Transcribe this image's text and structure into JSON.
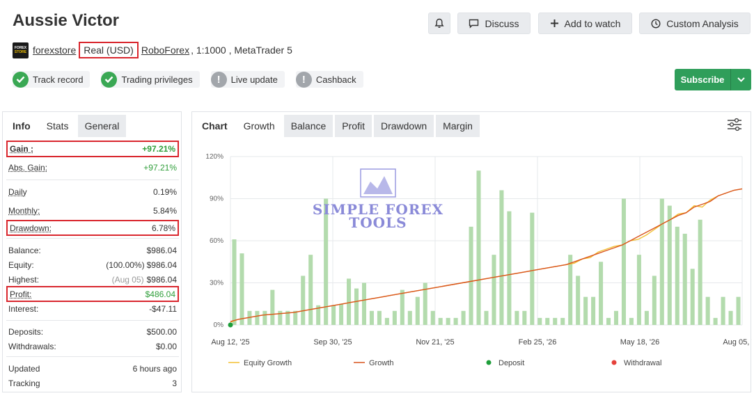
{
  "title": "Aussie Victor",
  "header_buttons": {
    "discuss": "Discuss",
    "add_to_watch": "Add to watch",
    "custom_analysis": "Custom Analysis"
  },
  "account": {
    "logo_top": "FOREX",
    "logo_bottom": "STORE",
    "owner": "forexstore",
    "type": "Real (USD)",
    "broker": "RoboForex",
    "details": ", 1:1000 , MetaTrader 5"
  },
  "badges": [
    {
      "label": "Track record",
      "status": "ok"
    },
    {
      "label": "Trading privileges",
      "status": "ok"
    },
    {
      "label": "Live update",
      "status": "warn"
    },
    {
      "label": "Cashback",
      "status": "warn"
    }
  ],
  "subscribe": "Subscribe",
  "left_tabs": [
    "Info",
    "Stats",
    "General"
  ],
  "stats": {
    "gain": {
      "label": "Gain :",
      "value": "+97.21%"
    },
    "abs_gain": {
      "label": "Abs. Gain:",
      "value": "+97.21%"
    },
    "daily": {
      "label": "Daily",
      "value": "0.19%"
    },
    "monthly": {
      "label": "Monthly:",
      "value": "5.84%"
    },
    "drawdown": {
      "label": "Drawdown:",
      "value": "6.78%"
    },
    "balance": {
      "label": "Balance:",
      "value": "$986.04"
    },
    "equity": {
      "label": "Equity:",
      "note": "(100.00%)",
      "value": "$986.04"
    },
    "highest": {
      "label": "Highest:",
      "note": "(Aug 05)",
      "value": "$986.04"
    },
    "profit": {
      "label": "Profit:",
      "value": "$486.04"
    },
    "interest": {
      "label": "Interest:",
      "value": "-$47.11"
    },
    "deposits": {
      "label": "Deposits:",
      "value": "$500.00"
    },
    "withdrawals": {
      "label": "Withdrawals:",
      "value": "$0.00"
    },
    "updated": {
      "label": "Updated",
      "value": "6 hours ago"
    },
    "tracking": {
      "label": "Tracking",
      "value": "3"
    }
  },
  "chart_tabs": [
    "Chart",
    "Growth",
    "Balance",
    "Profit",
    "Drawdown",
    "Margin"
  ],
  "active_chart_tab": "Growth",
  "watermark": {
    "line1": "SIMPLE FOREX",
    "line2": "TOOLS"
  },
  "colors": {
    "green": "#2f9e3a",
    "growth_line": "#d9541e",
    "equity_line": "#f2c033",
    "bars": "#b3dbad",
    "deposit": "#1e9e3a",
    "withdrawal": "#e5413b",
    "highlight_box": "#d9262d"
  },
  "chart_data": {
    "type": "bar",
    "ylim": [
      0,
      120
    ],
    "yticks": [
      "0%",
      "30%",
      "60%",
      "90%",
      "120%"
    ],
    "xticks": [
      "Aug 12, '25",
      "Sep 30, '25",
      "Nov 21, '25",
      "Feb 25, '26",
      "May 18, '26",
      "Aug 05, '26"
    ],
    "n": 64,
    "bars": [
      61,
      51,
      10,
      10,
      10,
      25,
      10,
      10,
      10,
      35,
      50,
      14,
      90,
      14,
      15,
      33,
      26,
      30,
      10,
      10,
      5,
      10,
      25,
      10,
      20,
      30,
      10,
      5,
      5,
      5,
      10,
      70,
      110,
      10,
      50,
      96,
      81,
      10,
      10,
      80,
      5,
      5,
      5,
      5,
      50,
      35,
      20,
      20,
      45,
      5,
      10,
      90,
      5,
      50,
      10,
      35,
      90,
      85,
      70,
      65,
      40,
      75,
      20,
      5,
      20,
      10,
      20
    ],
    "growth": [
      2.5,
      4,
      5,
      6,
      7,
      7.5,
      8,
      8.5,
      9,
      10,
      11,
      12,
      13,
      14,
      15,
      16,
      17,
      18,
      19,
      20,
      21,
      22,
      23,
      24,
      25,
      26,
      27,
      28,
      29,
      30,
      31,
      32,
      33,
      34,
      35,
      36,
      37,
      38,
      39,
      40,
      41,
      42,
      43,
      45,
      47,
      49,
      51,
      53,
      55,
      57,
      60,
      63,
      66,
      69,
      72,
      75,
      78,
      80,
      84,
      86,
      88,
      92,
      94,
      96,
      97
    ],
    "equity": [
      2,
      4,
      5,
      6,
      7,
      7.5,
      8,
      8.5,
      9,
      10,
      11,
      12,
      13,
      14,
      15,
      16,
      17,
      18,
      19,
      20,
      21,
      22,
      23,
      24,
      25,
      26,
      27,
      28,
      29,
      30,
      31,
      32,
      33,
      34,
      35,
      36,
      37,
      38,
      39,
      40,
      41,
      42,
      43,
      44,
      47,
      48,
      52,
      54,
      56,
      57,
      60,
      61,
      64,
      68,
      72,
      75,
      79,
      80,
      85,
      84,
      89,
      92,
      94,
      96,
      97
    ],
    "series": [
      {
        "name": "Equity Growth"
      },
      {
        "name": "Growth"
      },
      {
        "name": "Deposit"
      },
      {
        "name": "Withdrawal"
      }
    ]
  }
}
